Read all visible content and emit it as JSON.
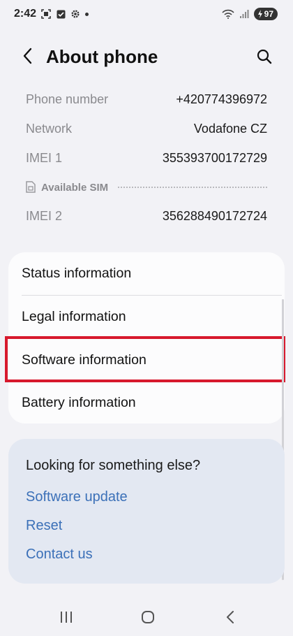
{
  "status_bar": {
    "time": "2:42",
    "battery": "97",
    "icons": [
      "screenshot-icon",
      "checkbox-icon",
      "settings-gear-icon",
      "dot-icon",
      "wifi-icon",
      "signal-icon",
      "battery-icon"
    ]
  },
  "header": {
    "title": "About phone",
    "back_icon": "back-arrow-icon",
    "search_icon": "search-icon"
  },
  "info": {
    "rows": [
      {
        "label": "Phone number",
        "value": "+420774396972"
      },
      {
        "label": "Network",
        "value": "Vodafone CZ"
      },
      {
        "label": "IMEI 1",
        "value": "355393700172729"
      },
      {
        "label": "IMEI 2",
        "value": "356288490172724"
      }
    ],
    "sim_label": "Available SIM"
  },
  "menu": {
    "items": [
      {
        "label": "Status information"
      },
      {
        "label": "Legal information"
      },
      {
        "label": "Software information"
      },
      {
        "label": "Battery information"
      }
    ],
    "highlighted_index": 2,
    "highlight_color": "#d7192d"
  },
  "suggestions": {
    "title": "Looking for something else?",
    "links": [
      {
        "label": "Software update"
      },
      {
        "label": "Reset"
      },
      {
        "label": "Contact us"
      }
    ],
    "link_color": "#3b70b8"
  },
  "nav_bar": {
    "icons": [
      "recent-apps-icon",
      "home-icon",
      "back-icon"
    ]
  }
}
